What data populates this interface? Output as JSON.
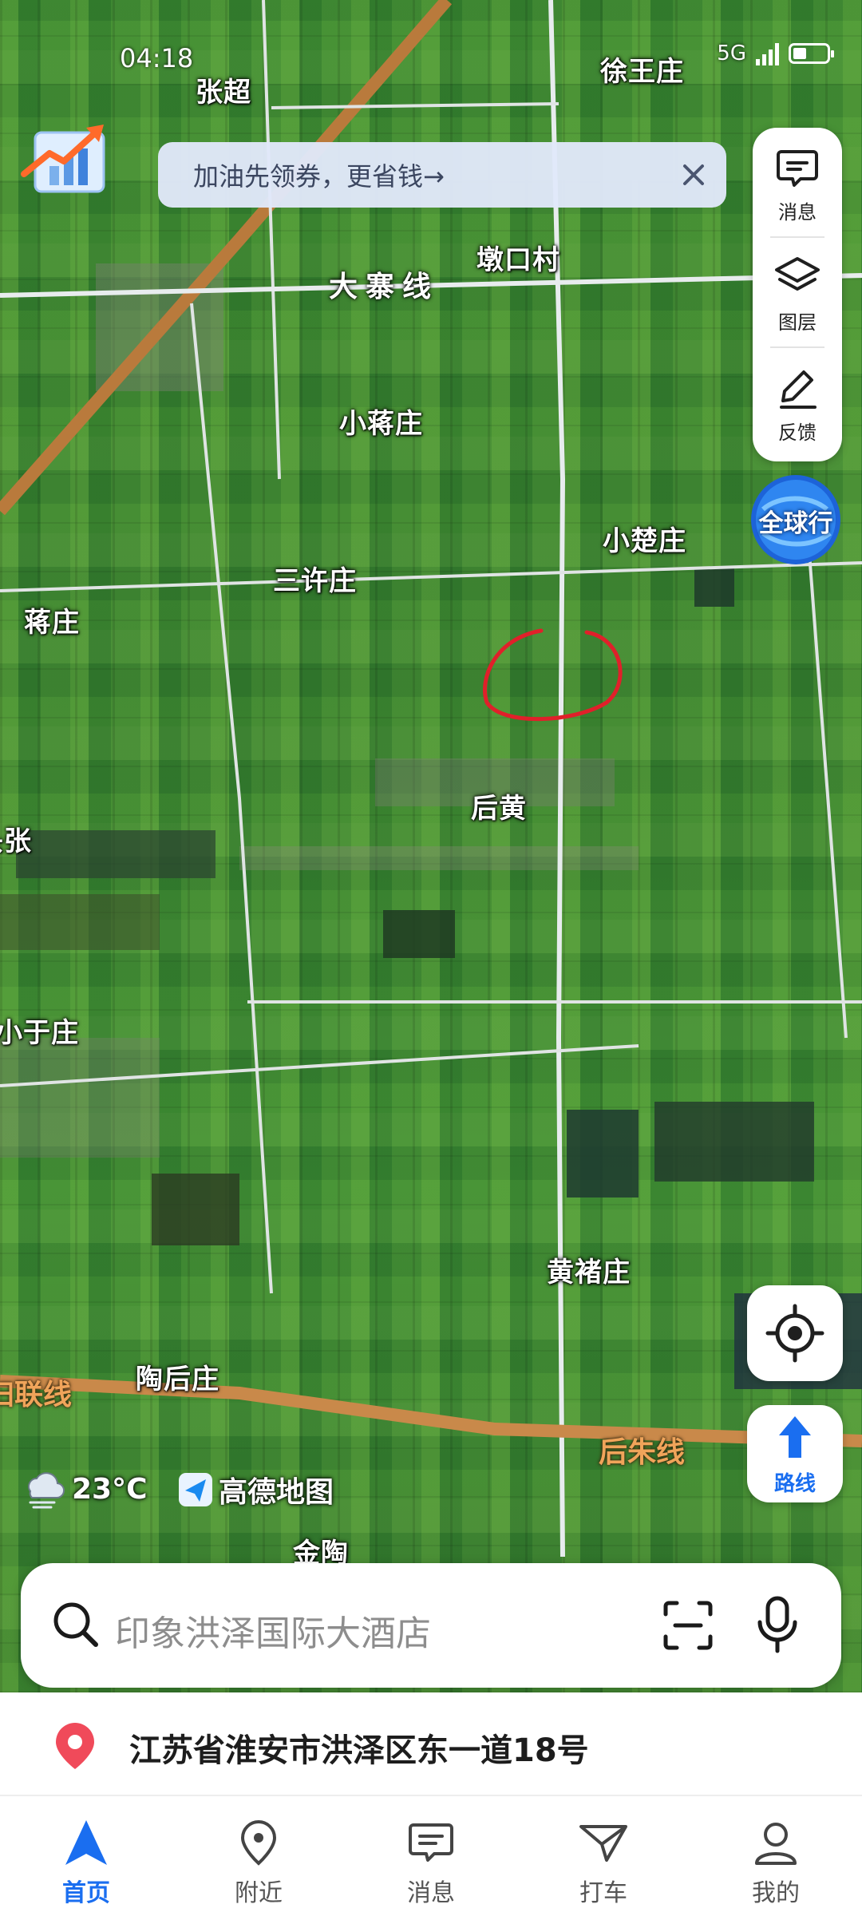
{
  "status_bar": {
    "time": "04:18",
    "network": "5G"
  },
  "promo": {
    "text": "加油先领券，更省钱→"
  },
  "side_tools": [
    {
      "label": "消息",
      "icon": "message-icon"
    },
    {
      "label": "图层",
      "icon": "layers-icon"
    },
    {
      "label": "反馈",
      "icon": "feedback-icon"
    }
  ],
  "globe_button": {
    "label": "全球行"
  },
  "map": {
    "places": {
      "zhangchao": "张超",
      "xuwangzhuang": "徐王庄",
      "dunkoucun": "墩口村",
      "xiaojiangzhuang": "小蒋庄",
      "xiaochuzhuang": "小楚庄",
      "sanxuzhuang": "三许庄",
      "jiangzhuang": "蒋庄",
      "houhuang": "后黄",
      "toutzhang": "头张",
      "xiaoyuzhuang": "小于庄",
      "huangchuzhuang": "黄褚庄",
      "taohouzhuang": "陶后庄",
      "jintao": "金陶"
    },
    "roads": {
      "dazhaixian": "大寨线",
      "guilianxian": "归联线",
      "houzhuxian": "后朱线"
    },
    "annotation": {
      "color": "#e0202a"
    }
  },
  "route_button": {
    "label": "路线"
  },
  "weather": {
    "temperature": "23°C"
  },
  "brand": {
    "name": "高德地图"
  },
  "search": {
    "placeholder": "印象洪泽国际大酒店"
  },
  "address": {
    "text": "江苏省淮安市洪泽区东一道18号"
  },
  "bottom_nav": [
    {
      "label": "首页",
      "active": true
    },
    {
      "label": "附近",
      "active": false
    },
    {
      "label": "消息",
      "active": false
    },
    {
      "label": "打车",
      "active": false
    },
    {
      "label": "我的",
      "active": false
    }
  ],
  "colors": {
    "accent": "#1a6ef0",
    "pin": "#f04a5a",
    "road_label": "#f0a45a"
  }
}
